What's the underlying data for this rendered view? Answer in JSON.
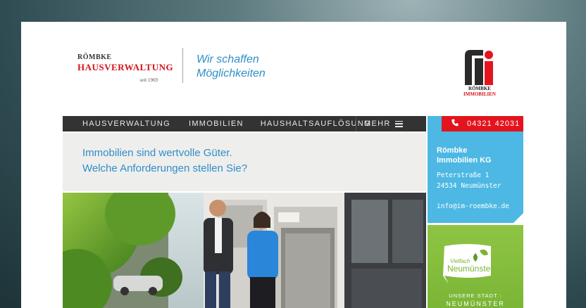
{
  "logo_hausverwaltung": {
    "line1": "RÖMBKE",
    "line2": "HAUSVERWALTUNG",
    "since": "seit 1969"
  },
  "slogan": {
    "line1": "Wir schaffen",
    "line2": "Möglichkeiten"
  },
  "logo_immobilien": {
    "line1": "RÖMBKE",
    "line2": "IMMOBILIEN"
  },
  "nav": {
    "items": [
      {
        "label": "HAUSVERWALTUNG"
      },
      {
        "label": "IMMOBILIEN"
      },
      {
        "label": "HAUSHALTSAUFLÖSUNG"
      }
    ],
    "more_label": "MEHR"
  },
  "phone": {
    "icon": "phone-icon",
    "number": "04321 42031"
  },
  "tagline": {
    "line1": "Immobilien sind wertvolle Güter.",
    "line2": "Welche Anforderungen stellen Sie?"
  },
  "contact": {
    "company_line1": "Römbke",
    "company_line2": "Immobilien KG",
    "street": "Peterstraße 1",
    "city": "24534 Neumünster",
    "email": "info@im-roembke.de"
  },
  "promo": {
    "badge_small": "Vielfach",
    "badge_big": "Neumünster",
    "subtitle": "UNSERE STADT :",
    "city": "NEUMÜNSTER"
  },
  "colors": {
    "brand_red": "#e3141e",
    "brand_blue": "#2f8ec6",
    "panel_blue": "#4cb8e3",
    "panel_green": "#8fc443",
    "nav_bg": "#333333"
  }
}
